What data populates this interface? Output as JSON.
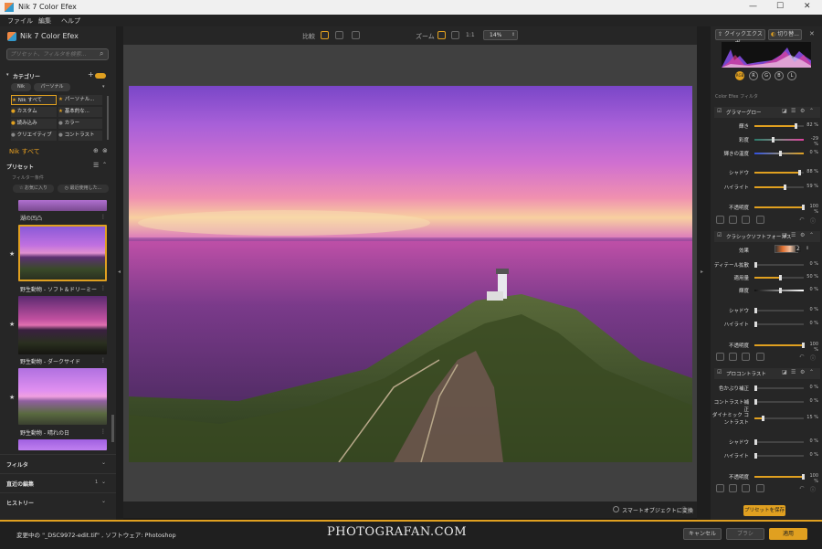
{
  "window": {
    "title": "Nik 7 Color Efex",
    "min": "—",
    "max": "☐",
    "close": "✕"
  },
  "menu": [
    "ファイル",
    "編集",
    "ヘルプ"
  ],
  "left": {
    "brand": "Nik 7 Color Efex",
    "search_placeholder": "プリセット、フィルタを検索...",
    "category_label": "カテゴリー",
    "category_tabs": [
      "Nik",
      "パーソナル"
    ],
    "categories": [
      {
        "label": "Nik すべて",
        "active": true
      },
      {
        "label": "パーソナル..."
      },
      {
        "label": "カスタム"
      },
      {
        "label": "基本的な..."
      },
      {
        "label": "読み込み"
      },
      {
        "label": "カラー"
      },
      {
        "label": "クリエイティブ"
      },
      {
        "label": "コントラスト"
      }
    ],
    "current": "Nik すべて",
    "presets_label": "プリセット",
    "filter_cond": "フィルター条件",
    "chip_fav": "お気に入り",
    "chip_recent": "最近使用した...",
    "presets": [
      {
        "label": "湖の凹凸"
      },
      {
        "label": "野生動物 - ソフト＆ドリーミー",
        "selected": true
      },
      {
        "label": "野生動物 - ダークサイド"
      },
      {
        "label": "野生動物 - 晴れの日"
      }
    ],
    "sections": [
      {
        "label": "フィルタ",
        "extra": ""
      },
      {
        "label": "直近の編集",
        "extra": "1"
      },
      {
        "label": "ヒストリー",
        "extra": ""
      }
    ]
  },
  "toolbar": {
    "compare": "比較",
    "zoom": "ズーム",
    "zoom_11": "1:1",
    "zoom_value": "14%"
  },
  "canvas_bottom": {
    "smart_object": "スマートオブジェクトに変換"
  },
  "right": {
    "quick_export": "クイックエクスポ...",
    "crop": "切り替...",
    "channels": [
      "RGB",
      "R",
      "G",
      "B",
      "L"
    ],
    "filter_header": "Color Efex フィルタ",
    "filters": [
      {
        "name": "グラマーグロー",
        "params": [
          {
            "label": "輝き",
            "value": "82 %",
            "frac": 0.82
          },
          {
            "label": "彩度",
            "value": "-29 %",
            "frac": 0.35
          },
          {
            "label": "輝きの温度",
            "value": "0 %",
            "frac": 0.5
          },
          {
            "label": "シャドウ",
            "value": "88 %",
            "frac": 0.88
          },
          {
            "label": "ハイライト",
            "value": "59 %",
            "frac": 0.59
          },
          {
            "label": "不透明度",
            "value": "100 %",
            "frac": 1.0
          }
        ]
      },
      {
        "name": "クラシックソフトフォーカス",
        "params": [
          {
            "label": "効果",
            "value": "2",
            "frac": 0.7
          },
          {
            "label": "ディテール拡散",
            "value": "0 %",
            "frac": 0.0
          },
          {
            "label": "適用量",
            "value": "50 %",
            "frac": 0.5
          },
          {
            "label": "輝度",
            "value": "0 %",
            "frac": 0.5
          },
          {
            "label": "シャドウ",
            "value": "0 %",
            "frac": 0.0
          },
          {
            "label": "ハイライト",
            "value": "0 %",
            "frac": 0.0
          },
          {
            "label": "不透明度",
            "value": "100 %",
            "frac": 1.0
          }
        ]
      },
      {
        "name": "プロコントラスト",
        "params": [
          {
            "label": "色かぶり補正",
            "value": "0 %",
            "frac": 0.0
          },
          {
            "label": "コントラスト補正",
            "value": "0 %",
            "frac": 0.0
          },
          {
            "label": "ダイナミック コントラスト",
            "value": "15 %",
            "frac": 0.15
          },
          {
            "label": "シャドウ",
            "value": "0 %",
            "frac": 0.0
          },
          {
            "label": "ハイライト",
            "value": "0 %",
            "frac": 0.0
          },
          {
            "label": "不透明度",
            "value": "100 %",
            "frac": 1.0
          }
        ]
      }
    ],
    "save_preset": "プリセットを保存"
  },
  "status": {
    "file": "変更中の \"_DSC9972-edit.tif\" , ソフトウェア: Photoshop",
    "watermark": "PHOTOGRAFAN.COM",
    "cancel": "キャンセル",
    "brush": "ブラシ",
    "apply": "適用"
  },
  "colors": {
    "accent": "#e0a020",
    "panel": "#262626",
    "canvas": "#404040"
  }
}
